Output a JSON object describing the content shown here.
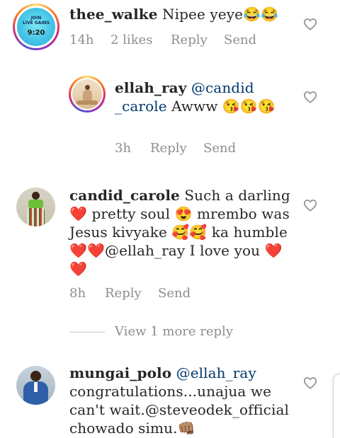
{
  "comments": [
    {
      "username": "thee_walke",
      "text": " Nipee yeye😂😂",
      "time": "14h",
      "likes": "2 likes",
      "reply": "Reply",
      "send": "Send",
      "avatar_text": [
        "JOIN",
        "LIVE GAINS",
        "9:20"
      ]
    },
    {
      "username": "ellah_ray",
      "mention": "@candid_carole",
      "mention_line1": "@candid",
      "mention_line2": "_carole",
      "text": " Awww 😘😘😘",
      "time": "3h",
      "reply": "Reply",
      "send": "Send"
    },
    {
      "username": "candid_carole",
      "lines": [
        " Such a darling",
        "❤️ pretty soul 😍 mrembo was",
        "Jesus kivyake 🥰🥰 ka humble",
        "❤️❤️@ellah_ray I love you ❤️",
        "❤️"
      ],
      "time": "8h",
      "reply": "Reply",
      "send": "Send"
    },
    {
      "username": "mungai_polo",
      "mention": "@ellah_ray",
      "lines": [
        "congratulations...unajua we",
        "can't wait.@steveodek_official",
        "chowado simu.👊🏽"
      ]
    }
  ],
  "view_more": "View 1 more reply",
  "colors": {
    "text": "#262626",
    "meta": "#8e8e8e",
    "mention": "#00376b"
  }
}
